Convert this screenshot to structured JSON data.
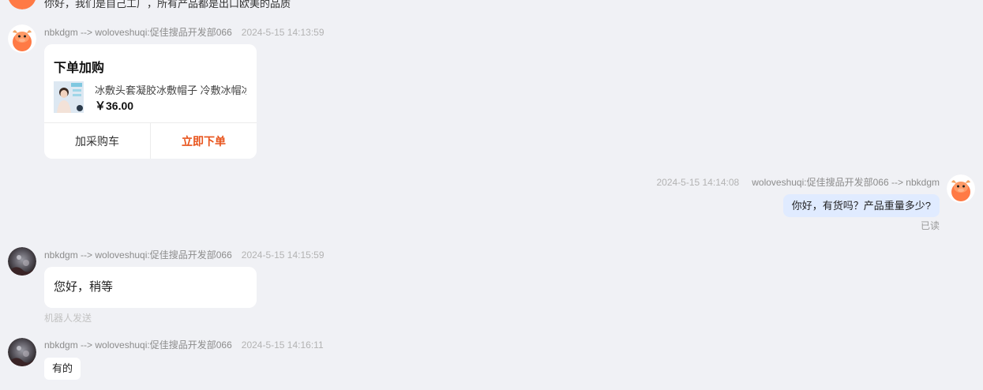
{
  "top_partial": {
    "text": "你好，我们是自己工厂，所有产品都是出口欧美的品质"
  },
  "messages": [
    {
      "sender": "nbkdgm --> woloveshuqi:促佳搜品开发部066",
      "time": "2024-5-15 14:13:59",
      "card": {
        "title": "下单加购",
        "product_name": "冰敷头套凝胶冰敷帽子 冷敷冰帽冰敷头套",
        "price": "￥36.00",
        "add_cart_label": "加采购车",
        "order_now_label": "立即下单"
      }
    },
    {
      "sender": "woloveshuqi:促佳搜品开发部066 --> nbkdgm",
      "time": "2024-5-15 14:14:08",
      "text": "你好，有货吗？产品重量多少?",
      "status": "已读"
    },
    {
      "sender": "nbkdgm --> woloveshuqi:促佳搜品开发部066",
      "time": "2024-5-15 14:15:59",
      "text": "您好，稍等",
      "note": "机器人发送"
    },
    {
      "sender": "nbkdgm --> woloveshuqi:促佳搜品开发部066",
      "time": "2024-5-15 14:16:11",
      "text": "有的"
    }
  ],
  "colors": {
    "background": "#f0f1f5",
    "accent_orange": "#e8541c",
    "mine_bubble": "#e0ebff"
  },
  "icons": {
    "brand_avatar": "cartoon-ox-avatar",
    "user_avatar": "user-photo-avatar"
  }
}
